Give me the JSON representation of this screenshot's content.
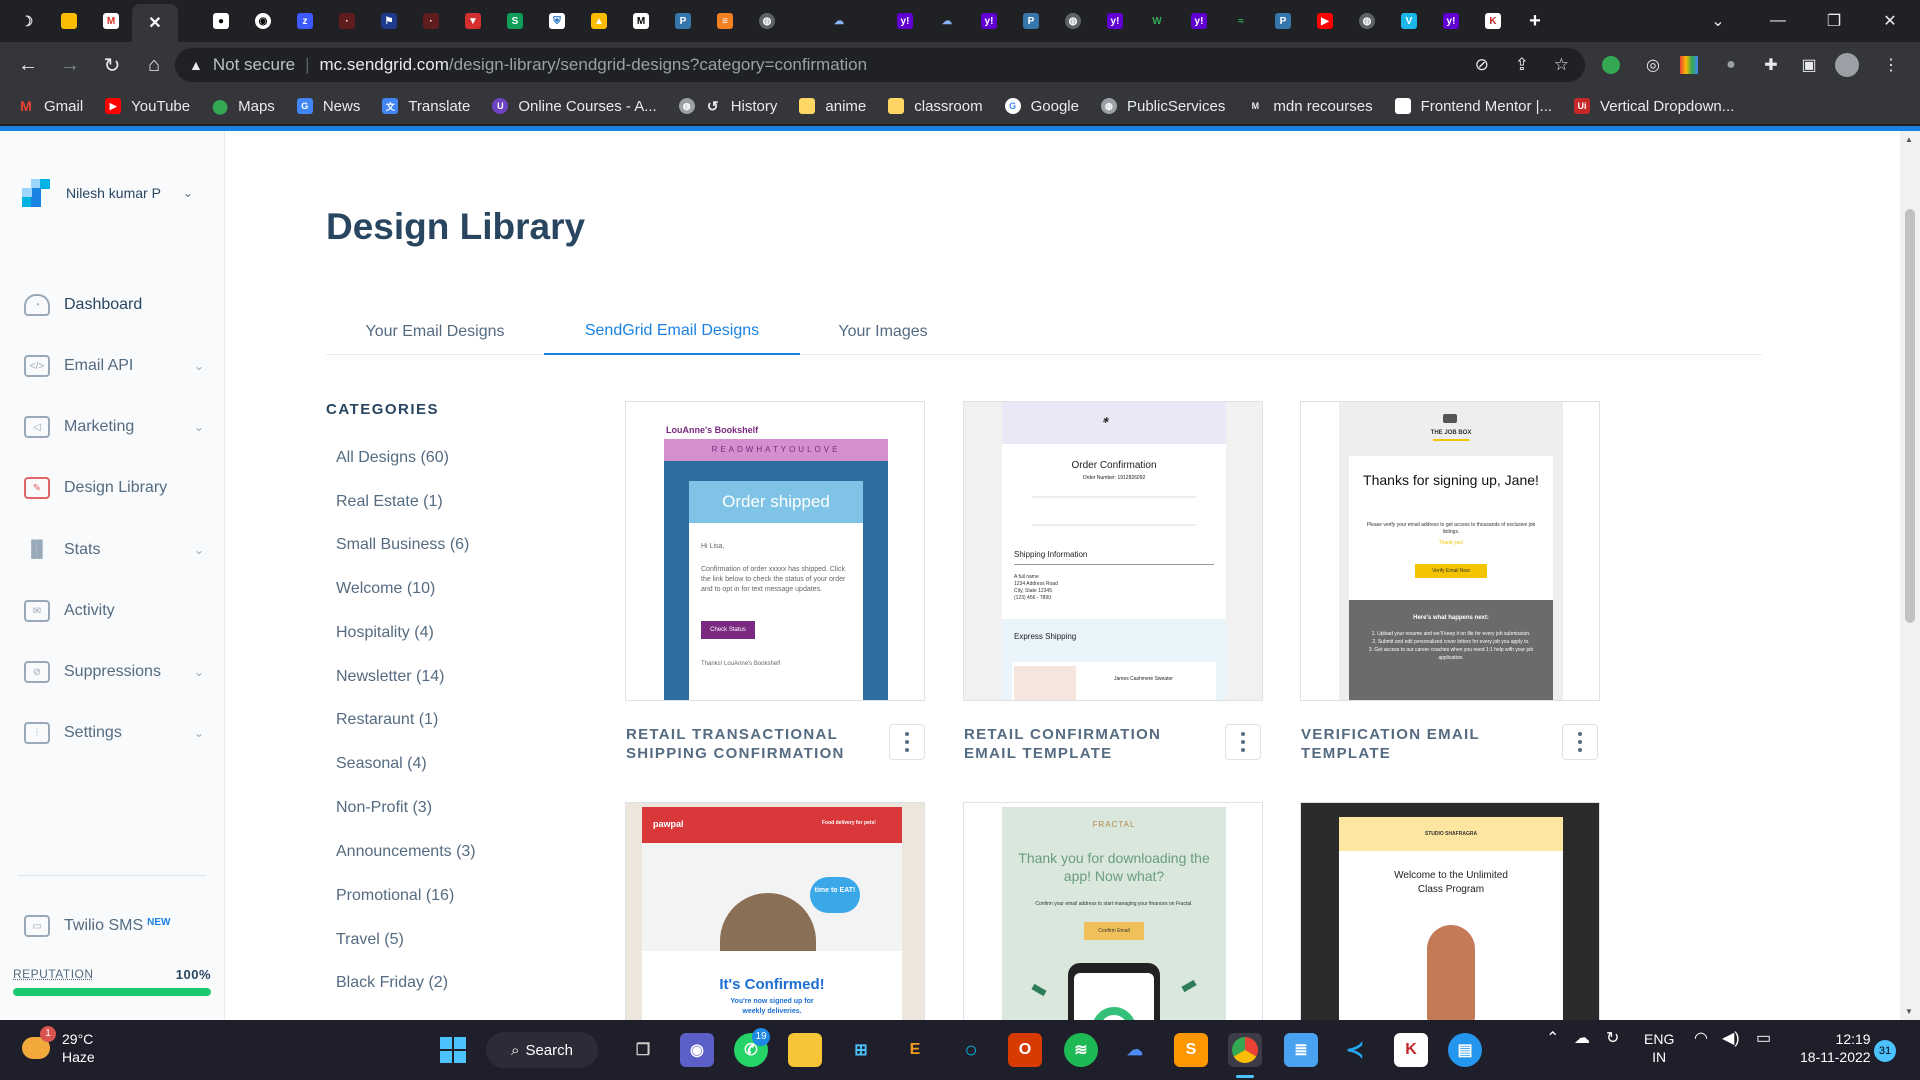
{
  "browser": {
    "address": {
      "security": "Not secure",
      "host": "mc.sendgrid.com",
      "path": "/design-library/sendgrid-designs?category=confirmation"
    },
    "bookmarks": [
      "Gmail",
      "YouTube",
      "Maps",
      "News",
      "Translate",
      "Online Courses - A...",
      "History",
      "anime",
      "classroom",
      "Google",
      "PublicServices",
      "mdn recourses",
      "Frontend Mentor |...",
      "Vertical Dropdown..."
    ]
  },
  "sidebar": {
    "user": "Nilesh kumar P",
    "items": [
      "Dashboard",
      "Email API",
      "Marketing",
      "Design Library",
      "Stats",
      "Activity",
      "Suppressions",
      "Settings",
      "Twilio SMS"
    ],
    "new_badge": "NEW",
    "reputation_label": "REPUTATION",
    "reputation_value": "100%",
    "reputation_fraction": 1.0
  },
  "main": {
    "title": "Design Library",
    "tabs": [
      "Your Email Designs",
      "SendGrid Email Designs",
      "Your Images"
    ],
    "categories_heading": "CATEGORIES",
    "categories": [
      "All Designs (60)",
      "Real Estate (1)",
      "Small Business (6)",
      "Welcome (10)",
      "Hospitality (4)",
      "Newsletter (14)",
      "Restaraunt (1)",
      "Seasonal (4)",
      "Non-Profit (3)",
      "Announcements (3)",
      "Promotional (16)",
      "Travel (5)",
      "Black Friday (2)"
    ],
    "cards": [
      {
        "name": "RETAIL TRANSACTIONAL SHIPPING CONFIRMATION"
      },
      {
        "name": "RETAIL CONFIRMATION EMAIL TEMPLATE"
      },
      {
        "name": "VERIFICATION EMAIL TEMPLATE"
      }
    ],
    "previews": {
      "p1": {
        "brand": "LouAnne's Bookshelf",
        "banner": "READWHATYOULOVE",
        "heading": "Order shipped",
        "greet": "Hi Lisa,",
        "body": "Confirmation of order xxxxx has shipped. Click the link below to check the status of your order and to opt in for text message updates.",
        "button": "Check Status",
        "sign": "Thanks! LouAnne's Bookshelf"
      },
      "p2": {
        "heading": "Order Confirmation",
        "sub": "Order Number: 1912826092",
        "section": "Shipping Information",
        "address": "A full name\n1234 Address Road\nCity, State 12345\n(123) 456 - 7890",
        "express": "Express Shipping",
        "item": "James Cashmere Sweater"
      },
      "p3": {
        "brand": "THE JOB BOX",
        "heading": "Thanks for signing up, Jane!",
        "body": "Please verify your email address to get access to thousands of exclusive job listings.",
        "thanks": "Thank you!",
        "button": "Verify Email Now",
        "next": "Here's what happens next:",
        "steps": "1. Upload your resume and we'll keep it on file for every job submission.\n2. Submit and edit personalized cover letters for every job you apply to.\n3. Get access to our career coaches when you need 1:1 help with your job application."
      },
      "p4": {
        "brand": "pawpal",
        "tag": "Food delivery for pets!",
        "bubble": "time to EAT!",
        "heading": "It's Confirmed!",
        "body": "You're now signed up for weekly deliveries."
      },
      "p5": {
        "brand": "FRACTAL",
        "heading": "Thank you for downloading the app! Now what?",
        "body": "Confirm your email address to start managing your finances on Fractal.",
        "button": "Confirm Email"
      },
      "p6": {
        "brand": "STUDIO SHAFRAGRA",
        "heading": "Welcome to the Unlimited Class Program"
      }
    }
  },
  "taskbar": {
    "temp": "29°C",
    "condition": "Haze",
    "search": "Search",
    "lang1": "ENG",
    "lang2": "IN",
    "time": "12:19",
    "date": "18-11-2022",
    "notif": "31",
    "badge_weather": "1",
    "badge_whatsapp": "19"
  }
}
